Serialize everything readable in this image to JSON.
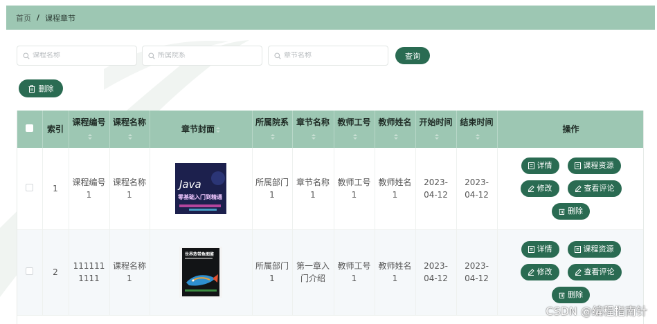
{
  "breadcrumb": {
    "home": "首页",
    "separator": "/",
    "current": "课程章节"
  },
  "search": {
    "course_name_placeholder": "课程名称",
    "department_placeholder": "所属院系",
    "chapter_name_placeholder": "章节名称",
    "query_label": "查询"
  },
  "toolbar": {
    "delete_label": "删除"
  },
  "table": {
    "headers": {
      "index": "索引",
      "course_no": "课程编号",
      "course_name": "课程名称",
      "cover": "章节封面",
      "department": "所属院系",
      "chapter_name": "章节名称",
      "teacher_no": "教师工号",
      "teacher_name": "教师姓名",
      "start_time": "开始时间",
      "end_time": "结束时间",
      "actions": "操作"
    },
    "rows": [
      {
        "index": "1",
        "course_no": "课程编号1",
        "course_name": "课程名称1",
        "cover_title_1": "Java",
        "cover_title_2": "零基础入门到精通",
        "department": "所属部门1",
        "chapter_name": "章节名称1",
        "teacher_no": "教师工号1",
        "teacher_name": "教师姓名1",
        "start_time": "2023-04-12",
        "end_time": "2023-04-12"
      },
      {
        "index": "2",
        "course_no": "1111111111",
        "course_name": "课程名称1",
        "cover_title_1": "世界热带鱼图鉴",
        "cover_title_2": "",
        "department": "所属部门1",
        "chapter_name": "第一章入门介绍",
        "teacher_no": "教师工号1",
        "teacher_name": "教师姓名1",
        "start_time": "2023-04-12",
        "end_time": "2023-04-12"
      }
    ],
    "row_actions": {
      "detail": "详情",
      "resources": "课程资源",
      "edit": "修改",
      "comments": "查看评论",
      "delete": "删除"
    }
  },
  "watermark": "CSDN @编程指南针",
  "colors": {
    "accent": "#2a6b52",
    "header_bg": "#9dc7b3"
  }
}
